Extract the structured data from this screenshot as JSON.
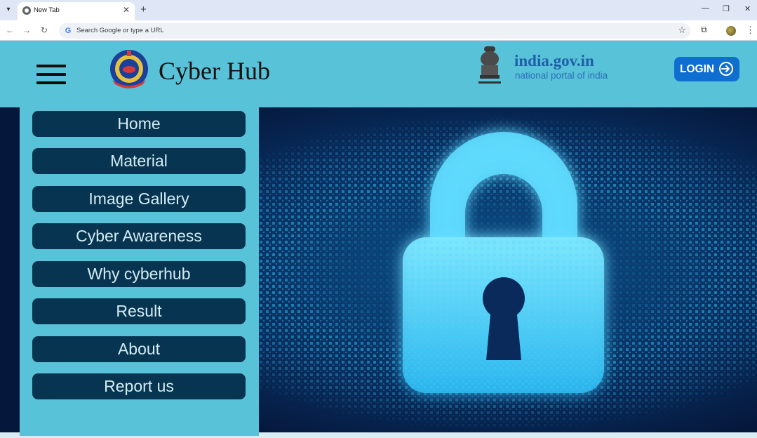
{
  "browser": {
    "tab_title": "New Tab",
    "omnibox_placeholder": "Search Google or type a URL",
    "google_glyph": "G"
  },
  "header": {
    "site_title": "Cyber Hub",
    "gov_portal_name": "india.gov.in",
    "gov_portal_sub": "national portal of india",
    "login_label": "LOGIN"
  },
  "menu": {
    "items": [
      {
        "label": "Home"
      },
      {
        "label": "Material"
      },
      {
        "label": "Image Gallery"
      },
      {
        "label": "Cyber Awareness"
      },
      {
        "label": "Why cyberhub"
      },
      {
        "label": "Result"
      },
      {
        "label": "About"
      },
      {
        "label": "Report us"
      }
    ]
  },
  "colors": {
    "header_bg": "#58c2d8",
    "menu_item_bg": "#073451",
    "login_bg": "#0f6fd1",
    "banner_bg": "#062046",
    "lock_glow": "#36d4ff"
  },
  "icons": {
    "menu": "hamburger-icon",
    "police_logo": "police-emblem-logo",
    "gov_logo": "national-emblem-logo",
    "login": "login-arrow-icon",
    "banner": "padlock-icon"
  }
}
